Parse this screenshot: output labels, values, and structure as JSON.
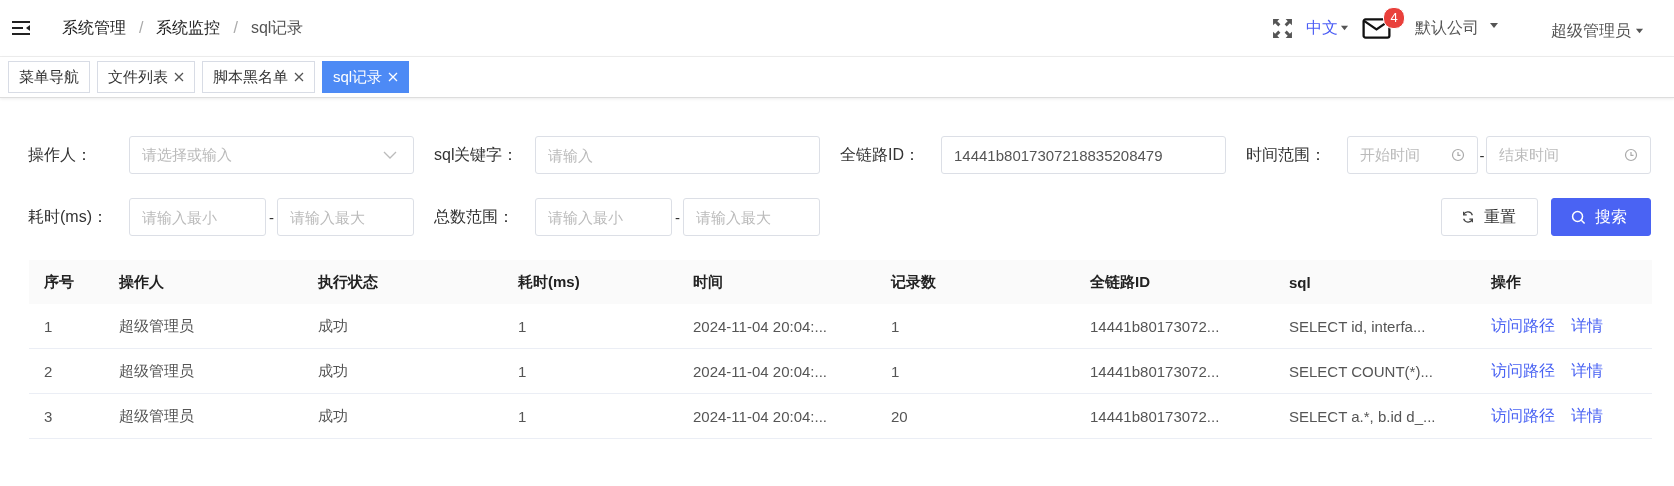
{
  "header": {
    "breadcrumb": [
      "系统管理",
      "系统监控",
      "sql记录"
    ],
    "separator": "/",
    "language": "中文",
    "mail_badge": "4",
    "company": "默认公司",
    "user": "超级管理员"
  },
  "tabs": [
    {
      "label": "菜单导航",
      "closable": false,
      "selected": false
    },
    {
      "label": "文件列表",
      "closable": true,
      "selected": false
    },
    {
      "label": "脚本黑名单",
      "closable": true,
      "selected": false
    },
    {
      "label": "sql记录",
      "closable": true,
      "selected": true
    }
  ],
  "filters": [
    {
      "kind": "select",
      "label": "操作人：",
      "placeholder": "请选择或输入"
    },
    {
      "kind": "text",
      "label": "sql关键字：",
      "placeholder": "请输入"
    },
    {
      "kind": "text",
      "label": "全链路ID：",
      "value": "14441b8017307218835208479"
    },
    {
      "kind": "time_range",
      "label": "时间范围：",
      "start_placeholder": "开始时间",
      "end_placeholder": "结束时间",
      "separator": "-"
    },
    {
      "kind": "range",
      "label": "耗时(ms)：",
      "min_placeholder": "请输入最小",
      "max_placeholder": "请输入最大",
      "separator": "-"
    },
    {
      "kind": "range",
      "label": "总数范围：",
      "min_placeholder": "请输入最小",
      "max_placeholder": "请输入最大",
      "separator": "-"
    }
  ],
  "buttons": [
    {
      "kind": "reset",
      "label": "重置"
    },
    {
      "kind": "search",
      "label": "搜索"
    }
  ],
  "table": {
    "columns": [
      "序号",
      "操作人",
      "执行状态",
      "耗时(ms)",
      "时间",
      "记录数",
      "全链路ID",
      "sql",
      "操作"
    ],
    "rows": [
      {
        "cells": [
          "1",
          "超级管理员",
          "成功",
          "1",
          "2024-11-04 20:04:...",
          "1",
          "14441b80173072...",
          "SELECT id, interfa..."
        ],
        "actions": [
          "访问路径",
          "详情"
        ]
      },
      {
        "cells": [
          "2",
          "超级管理员",
          "成功",
          "1",
          "2024-11-04 20:04:...",
          "1",
          "14441b80173072...",
          "SELECT COUNT(*)..."
        ],
        "actions": [
          "访问路径",
          "详情"
        ]
      },
      {
        "cells": [
          "3",
          "超级管理员",
          "成功",
          "1",
          "2024-11-04 20:04:...",
          "20",
          "14441b80173072...",
          "SELECT a.*, b.id d_..."
        ],
        "actions": [
          "访问路径",
          "详情"
        ]
      }
    ]
  }
}
